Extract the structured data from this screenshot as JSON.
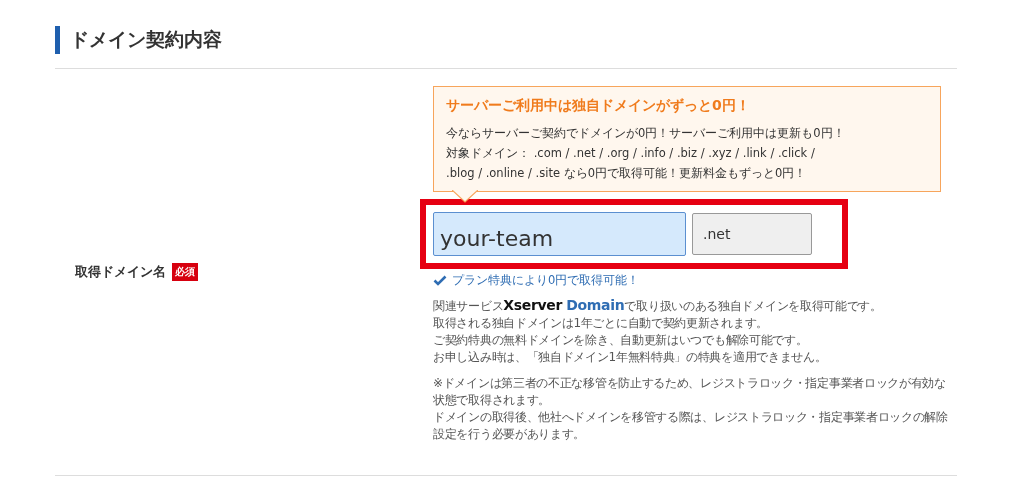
{
  "section": {
    "title": "ドメイン契約内容"
  },
  "field": {
    "label": "取得ドメイン名",
    "required_badge": "必須",
    "promo": {
      "title": "サーバーご利用中は独自ドメインがずっと0円！",
      "lines": [
        "今ならサーバーご契約でドメインが0円！サーバーご利用中は更新も0円！",
        "対象ドメイン：  .com / .net / .org / .info / .biz / .xyz / .link / .click /",
        ".blog / .online / .site なら0円で取得可能！更新料金もずっと0円！"
      ]
    },
    "highlighted": true,
    "domain_input": {
      "value": "your-team"
    },
    "tld_select": {
      "value": ".net"
    },
    "status": "プラン特典により0円で取得可能！",
    "notes": [
      {
        "before": "関連サービス",
        "logo_a": "Xserver",
        "logo_b": "Domain",
        "after": "で取り扱いのある独自ドメインを取得可能です。"
      },
      {
        "after": "取得される独自ドメインは1年ごとに自動で契約更新されます。"
      },
      {
        "after": "ご契約特典の無料ドメインを除き、自動更新はいつでも解除可能です。"
      },
      {
        "after": "お申し込み時は、「独自ドメイン1年無料特典」の特典を適用できません。"
      }
    ],
    "cautions": [
      "※ドメインは第三者の不正な移管を防止するため、レジストラロック・指定事業者ロックが有効な状態で取得されます。",
      "ドメインの取得後、他社へドメインを移管する際は、レジストラロック・指定事業者ロックの解除設定を行う必要があります。"
    ]
  }
}
